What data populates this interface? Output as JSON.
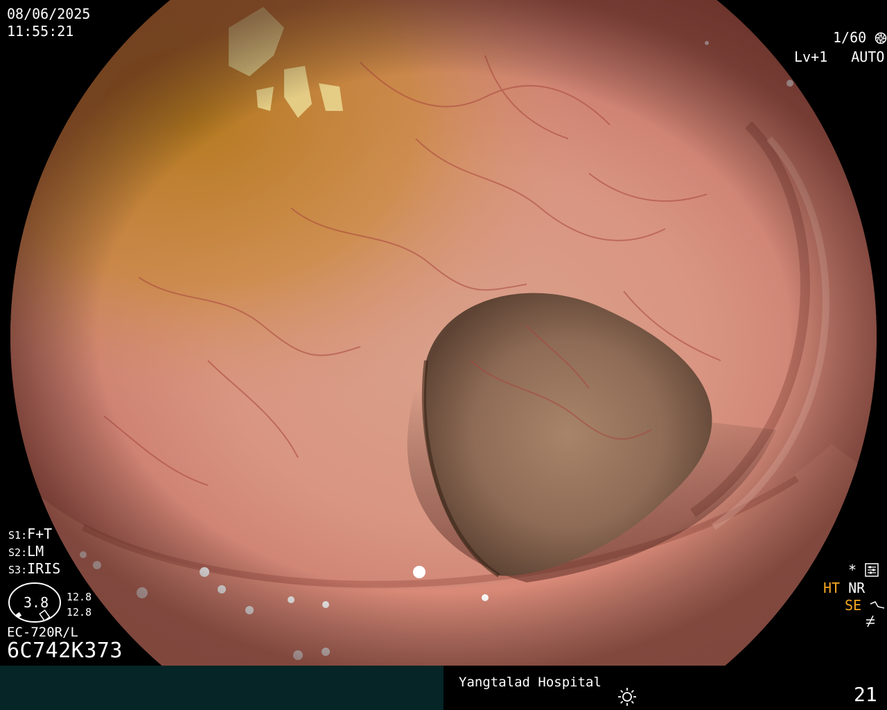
{
  "overlay": {
    "date": "08/06/2025",
    "time": "11:55:21",
    "shutter": "1/60",
    "level": "Lv+1",
    "exposure_mode": "AUTO",
    "settings": [
      {
        "key": "S1",
        "value": "F+T"
      },
      {
        "key": "S2",
        "value": "LM"
      },
      {
        "key": "S3",
        "value": "IRIS"
      }
    ],
    "zoom_value": "3.8",
    "zoom_readout_top": "12.8",
    "zoom_readout_bottom": "12.8",
    "scope_model": "EC-720R/L",
    "scope_serial": "6C742K373",
    "right_indicators": {
      "asterisk": "*",
      "ht": "HT",
      "nr": "NR",
      "se": "SE"
    }
  },
  "statusbar": {
    "hospital": "Yangtalad Hospital",
    "counter": "21"
  },
  "colors": {
    "accent_orange": "#f5a623",
    "statusbar_bg": "#062526",
    "overlay_text": "#ffffff"
  },
  "icons": [
    "shutter-icon",
    "auto-iris-icon",
    "settings-icon",
    "enhance-icon",
    "flash-off-icon",
    "brightness-icon"
  ]
}
